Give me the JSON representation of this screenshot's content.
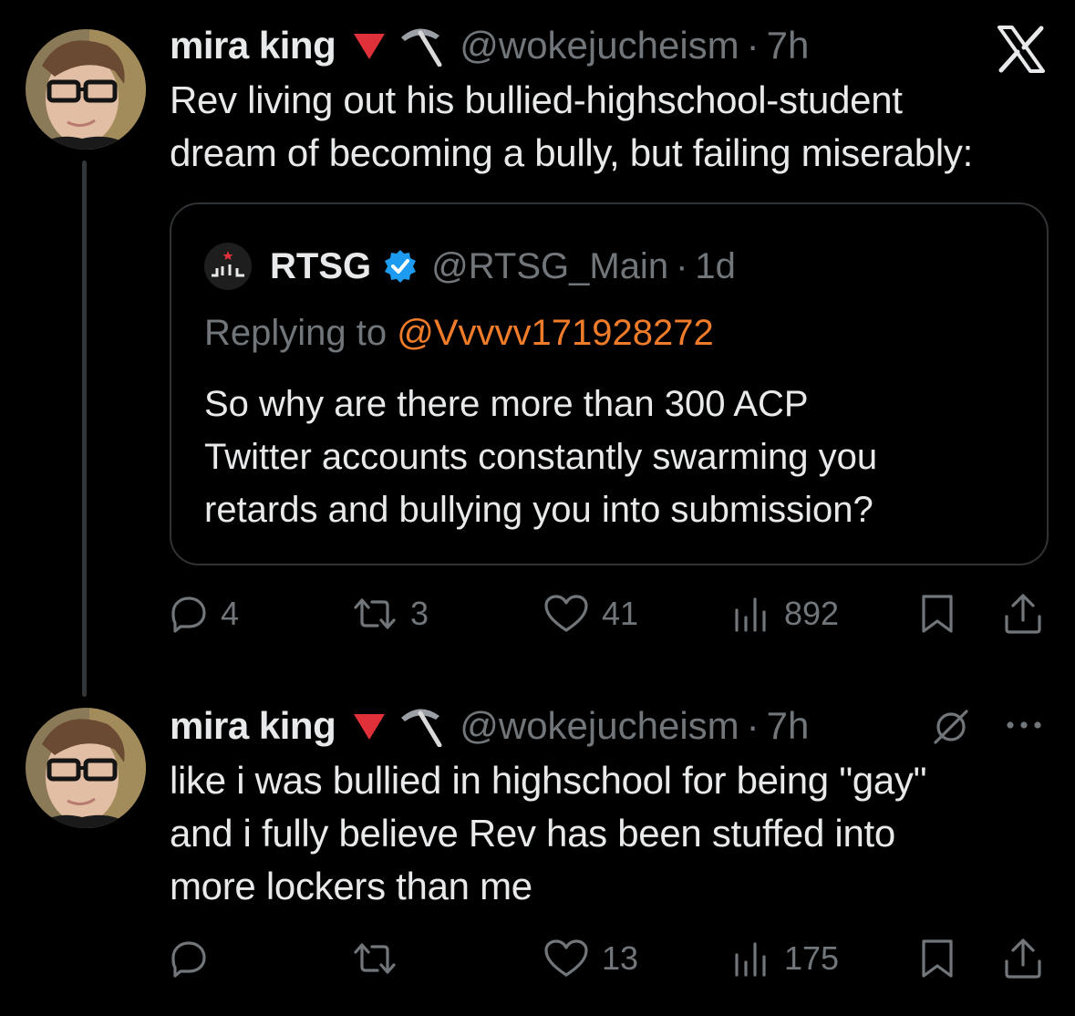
{
  "tweets": [
    {
      "author_name": "mira king",
      "emoji_1": "red-triangle-down",
      "emoji_2": "pick",
      "handle": "@wokejucheism",
      "separator": "·",
      "time": "7h",
      "text_lines": [
        "Rev living out his bullied-highschool-student",
        "dream of becoming a bully, but failing miserably:"
      ],
      "quote": {
        "author_name": "RTSG",
        "verified": true,
        "handle": "@RTSG_Main",
        "separator": "·",
        "time": "1d",
        "replying_prefix": "Replying to ",
        "replying_mention": "@Vvvvv171928272",
        "text_lines": [
          "So why are there more than 300 ACP",
          "Twitter accounts constantly swarming you",
          "retards and bullying you into submission?"
        ]
      },
      "actions": {
        "replies": "4",
        "reposts": "3",
        "likes": "41",
        "views": "892"
      }
    },
    {
      "author_name": "mira king",
      "emoji_1": "red-triangle-down",
      "emoji_2": "pick",
      "handle": "@wokejucheism",
      "separator": "·",
      "time": "7h",
      "text_lines": [
        "like i was bullied in highschool for being \"gay\"",
        "and i fully believe Rev has been stuffed into",
        "more lockers than me"
      ],
      "actions": {
        "replies": "",
        "reposts": "",
        "likes": "13",
        "views": "175"
      }
    }
  ],
  "colors": {
    "background": "#000000",
    "text": "#e7e9ea",
    "muted": "#71767b",
    "border": "#2f3336",
    "mention": "#f07c2a",
    "verified": "#1d9bf0",
    "emoji_red": "#e0303a"
  },
  "icons": {
    "platform": "x-logo-icon",
    "grok": "grok-icon",
    "more": "more-icon",
    "reply": "reply-icon",
    "repost": "repost-icon",
    "like": "heart-icon",
    "views": "views-icon",
    "bookmark": "bookmark-icon",
    "share": "share-icon"
  }
}
